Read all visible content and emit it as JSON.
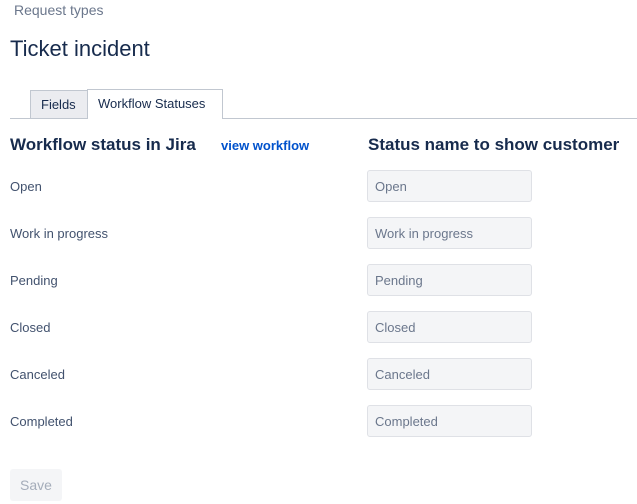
{
  "breadcrumb": "Request types",
  "page_title": "Ticket incident",
  "tabs": [
    {
      "label": "Fields",
      "active": false
    },
    {
      "label": "Workflow Statuses",
      "active": true
    }
  ],
  "left_column": {
    "heading": "Workflow status in Jira",
    "link_label": "view workflow"
  },
  "right_column": {
    "heading": "Status name to show customer"
  },
  "statuses": [
    {
      "jira_status": "Open",
      "customer_name": "Open"
    },
    {
      "jira_status": "Work in progress",
      "customer_name": "Work in progress"
    },
    {
      "jira_status": "Pending",
      "customer_name": "Pending"
    },
    {
      "jira_status": "Closed",
      "customer_name": "Closed"
    },
    {
      "jira_status": "Canceled",
      "customer_name": "Canceled"
    },
    {
      "jira_status": "Completed",
      "customer_name": "Completed"
    }
  ],
  "save_label": "Save",
  "colors": {
    "link": "#0052cc",
    "heading": "#172b4d",
    "muted_text": "#6b778c",
    "input_background": "#f4f5f7"
  }
}
